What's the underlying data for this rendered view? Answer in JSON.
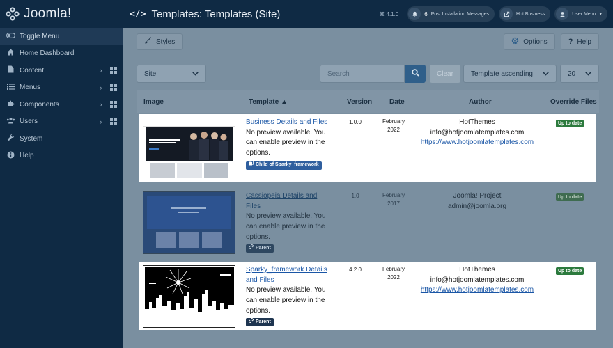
{
  "header": {
    "brand": "Joomla!",
    "title": "Templates: Templates (Site)",
    "version": "⌘ 4.1.0",
    "notifications_count": "6",
    "post_install_label": "Post Installation Messages",
    "site_label": "Hot Business",
    "user_menu_label": "User Menu"
  },
  "sidebar": {
    "items": [
      {
        "label": "Toggle Menu",
        "icon": "toggle-icon"
      },
      {
        "label": "Home Dashboard",
        "icon": "home-icon"
      },
      {
        "label": "Content",
        "icon": "file-icon"
      },
      {
        "label": "Menus",
        "icon": "list-icon"
      },
      {
        "label": "Components",
        "icon": "puzzle-icon"
      },
      {
        "label": "Users",
        "icon": "users-icon"
      },
      {
        "label": "System",
        "icon": "wrench-icon"
      },
      {
        "label": "Help",
        "icon": "info-icon"
      }
    ]
  },
  "toolbar": {
    "styles_label": "Styles",
    "options_label": "Options",
    "help_label": "Help"
  },
  "filters": {
    "client": "Site",
    "search_placeholder": "Search",
    "clear_label": "Clear",
    "ordering": "Template ascending",
    "limit": "20"
  },
  "table": {
    "columns": {
      "image": "Image",
      "template": "Template ▲",
      "version": "Version",
      "date": "Date",
      "author": "Author",
      "override": "Override Files"
    },
    "rows": [
      {
        "name_line1": "Business Details and Files",
        "name_line2": "",
        "description": [
          "No preview available. You",
          "can enable preview in the",
          "options."
        ],
        "tag": "Child of Sparky_framework",
        "version": "1.0.0",
        "date_month": "February",
        "date_year": "2022",
        "author": "HotThemes",
        "email": "info@hotjoomlatemplates.com",
        "url": "https://www.hotjoomlatemplates.com",
        "status": "Up to date"
      },
      {
        "name_line1": "Cassiopeia Details and",
        "name_line2": "Files",
        "description": [
          "No preview available. You",
          "can enable preview in the",
          "options."
        ],
        "tag": "Parent",
        "version": "1.0",
        "date_month": "February",
        "date_year": "2017",
        "author": "Joomla! Project",
        "email": "admin@joomla.org",
        "url": "",
        "status": "Up to date"
      },
      {
        "name_line1": "Sparky_framework Details",
        "name_line2": "and Files",
        "description": [
          "No preview available. You",
          "can enable preview in the",
          "options."
        ],
        "tag": "Parent",
        "version": "4.2.0",
        "date_month": "February",
        "date_year": "2022",
        "author": "HotThemes",
        "email": "info@hotjoomlatemplates.com",
        "url": "https://www.hotjoomlatemplates.com",
        "status": "Up to date"
      }
    ]
  }
}
